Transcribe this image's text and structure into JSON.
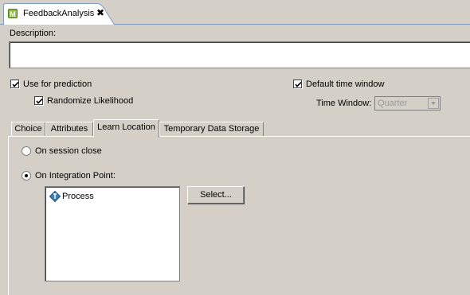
{
  "editor_tab": {
    "icon_letter": "M",
    "title": "FeedbackAnalysis",
    "close_symbol": "✖"
  },
  "description": {
    "label": "Description:",
    "value": ""
  },
  "use_for_prediction": {
    "label": "Use for prediction",
    "checked": true
  },
  "randomize_likelihood": {
    "label": "Randomize Likelihood",
    "checked": true
  },
  "default_time_window": {
    "label": "Default time window",
    "checked": true
  },
  "time_window": {
    "label": "Time Window:",
    "value": "Quarter",
    "enabled": false
  },
  "tabs": [
    {
      "label": "Choice",
      "selected": false
    },
    {
      "label": "Attributes",
      "selected": false
    },
    {
      "label": "Learn Location",
      "selected": true
    },
    {
      "label": "Temporary Data Storage",
      "selected": false
    }
  ],
  "learn_location": {
    "on_session_close": {
      "label": "On session close",
      "selected": false
    },
    "on_integration_point": {
      "label": "On Integration Point:",
      "selected": true
    },
    "integration_points": [
      {
        "label": "Process",
        "icon": "process-diamond-icon"
      }
    ],
    "select_button": "Select..."
  },
  "colors": {
    "background": "#d4d0c8",
    "tab_accent": "#7e9bc4",
    "icon_green": "#8dbb3f",
    "process_icon": "#3d7fb0"
  }
}
